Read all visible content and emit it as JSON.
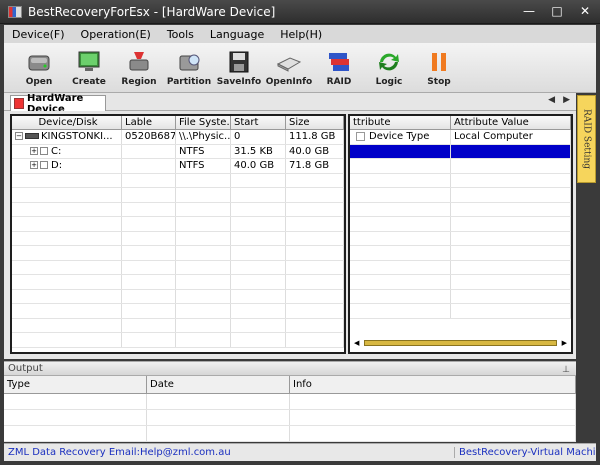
{
  "window": {
    "title": "BestRecoveryForEsx - [HardWare Device]",
    "controls": [
      "—",
      "□",
      "✕"
    ]
  },
  "menu": [
    {
      "label": "Device(F)"
    },
    {
      "label": "Operation(E)"
    },
    {
      "label": "Tools"
    },
    {
      "label": "Language"
    },
    {
      "label": "Help(H)"
    }
  ],
  "toolbar": [
    {
      "label": "Open",
      "icon": "disk-open-icon"
    },
    {
      "label": "Create",
      "icon": "monitor-create-icon"
    },
    {
      "label": "Region",
      "icon": "region-icon"
    },
    {
      "label": "Partition",
      "icon": "partition-icon"
    },
    {
      "label": "SaveInfo",
      "icon": "floppy-save-icon"
    },
    {
      "label": "OpenInfo",
      "icon": "open-info-icon"
    },
    {
      "label": "RAID",
      "icon": "raid-icon"
    },
    {
      "label": "Logic",
      "icon": "logic-arrows-icon"
    },
    {
      "label": "Stop",
      "icon": "stop-pause-icon"
    }
  ],
  "tab": {
    "label": "HardWare Device",
    "nav_prev": "◀",
    "nav_next": "▶"
  },
  "side_tab": {
    "label": "RAID Setting"
  },
  "device_grid": {
    "columns": [
      "Device/Disk",
      "Lable",
      "File Syste...",
      "Start",
      "Size"
    ],
    "rows": [
      {
        "device": "KINGSTONKI...",
        "label": "0520B687...",
        "fs": "\\\\.\\Physic...",
        "start": "0",
        "size": "111.8 GB",
        "expander": "−"
      },
      {
        "device": "C:",
        "label": "",
        "fs": "NTFS",
        "start": "31.5 KB",
        "size": "40.0 GB",
        "expander": "+"
      },
      {
        "device": "D:",
        "label": "",
        "fs": "NTFS",
        "start": "40.0 GB",
        "size": "71.8 GB",
        "expander": "+"
      }
    ]
  },
  "attr_grid": {
    "columns": [
      "ttribute",
      "Attribute Value"
    ],
    "rows": [
      {
        "attribute": "Device Type",
        "value": "Local Computer"
      },
      {
        "attribute": "",
        "value": ""
      }
    ]
  },
  "output": {
    "title": "Output",
    "pin": "⊥",
    "columns": [
      "Type",
      "Date",
      "Info"
    ]
  },
  "status": {
    "left": "ZML Data Recovery Email:Help@zml.com.au",
    "right": "BestRecovery-Virtual Machin"
  },
  "colors": {
    "selection": "#0000c8",
    "status_text": "#1a2fbf",
    "side_tab": "#f6d55c"
  }
}
